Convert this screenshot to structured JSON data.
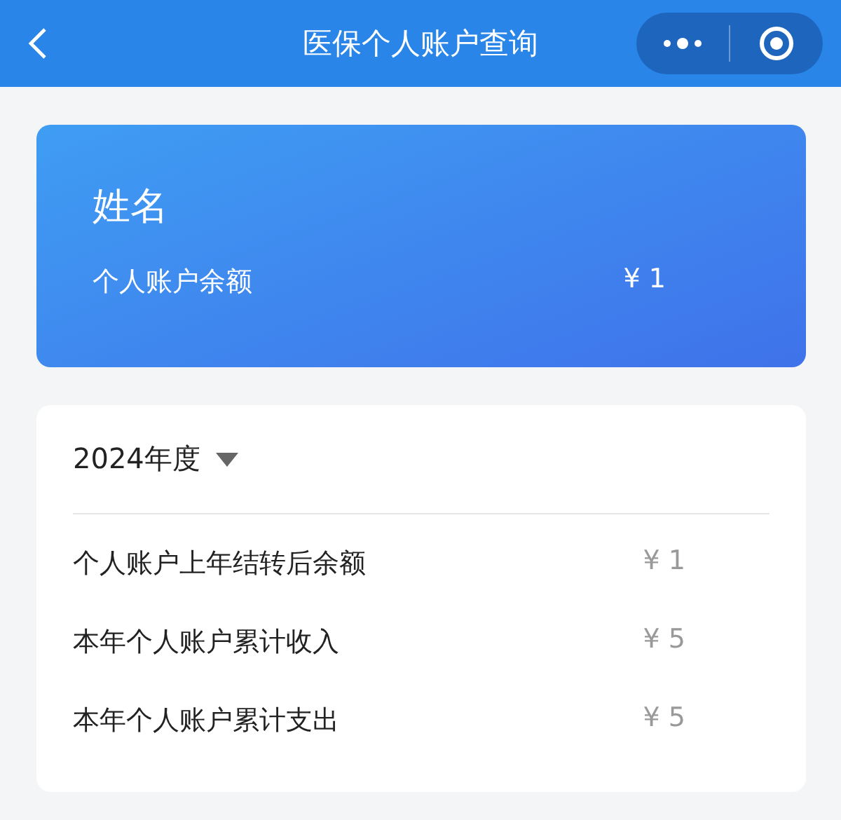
{
  "nav": {
    "title": "医保个人账户查询"
  },
  "account": {
    "name": "姓名",
    "balance_label": "个人账户余额",
    "balance": "¥ 1"
  },
  "year": {
    "label": "2024年度",
    "expanded": false
  },
  "rows": [
    {
      "label": "个人账户上年结转后余额",
      "value": "¥ 1"
    },
    {
      "label": "本年个人账户累计收入",
      "value": "¥ 5"
    },
    {
      "label": "本年个人账户累计支出",
      "value": "¥ 5"
    }
  ]
}
